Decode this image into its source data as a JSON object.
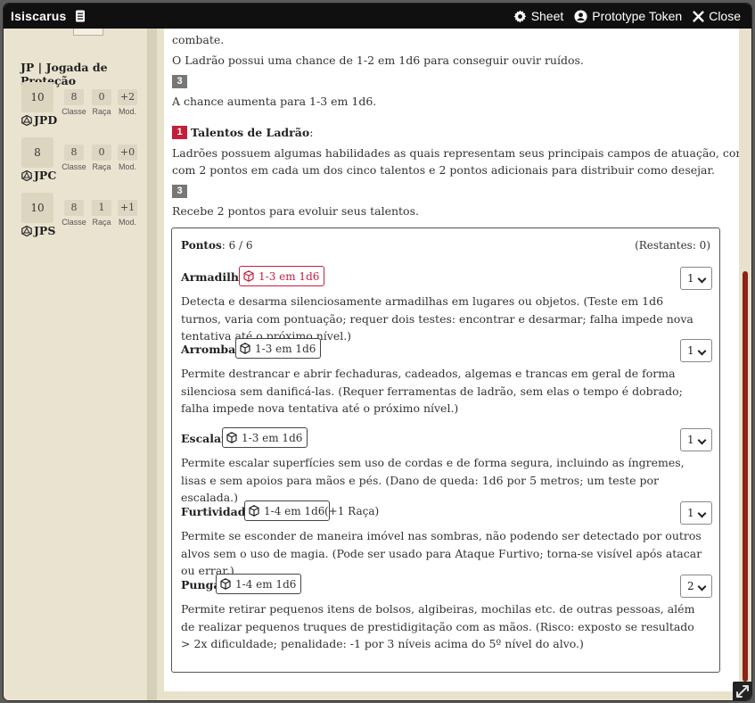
{
  "window": {
    "title": "Isiscarus",
    "sheet_label": "Sheet",
    "token_label": "Prototype Token",
    "close_label": "Close"
  },
  "sidebar": {
    "jp_title": "JP | Jogada de Proteção",
    "saves": [
      {
        "name": "JPD",
        "total": "10",
        "classe": "8",
        "raca": "0",
        "mod": "+2"
      },
      {
        "name": "JPC",
        "total": "8",
        "classe": "8",
        "raca": "0",
        "mod": "+0"
      },
      {
        "name": "JPS",
        "total": "10",
        "classe": "8",
        "raca": "1",
        "mod": "+1"
      }
    ],
    "labels": {
      "classe": "Classe",
      "raca": "Raça",
      "mod": "Mod."
    }
  },
  "main": {
    "line_combat": "combate.",
    "line_hear": "O Ladrão possui uma chance de 1-2 em 1d6 para conseguir ouvir ruídos.",
    "lvl_3a": "3",
    "line_chance": "A chance aumenta para 1-3 em 1d6.",
    "lvl_1": "1",
    "talents_title": "Talentos de Ladrão",
    "talents_colon": ":",
    "talents_desc_1": "Ladrões possuem algumas habilidades as quais representam seus principais campos de atuação, começando",
    "talents_desc_2": "com 2 pontos em cada um dos cinco talentos e 2 pontos adicionais para distribuir como desejar.",
    "lvl_3b": "3",
    "line_receive": "Recebe 2 pontos para evoluir seus talentos.",
    "points_label": "Pontos",
    "points_value": ": 6 / 6",
    "remaining": "(Restantes: 0)",
    "talents": [
      {
        "name": "Armadilha",
        "roll": "1-3 em 1d6",
        "bonus": "",
        "select": "1",
        "desc": "Detecta e desarma silenciosamente armadilhas em lugares ou objetos. (Teste em 1d6 turnos, varia com pontuação; requer dois testes: encontrar e desarmar; falha impede nova tentativa até o próximo nível.)"
      },
      {
        "name": "Arrombar",
        "roll": "1-3 em 1d6",
        "bonus": "",
        "select": "1",
        "desc": "Permite destrancar e abrir fechaduras, cadeados, algemas e trancas em geral de forma silenciosa sem danificá-las. (Requer ferramentas de ladrão, sem elas o tempo é dobrado; falha impede nova tentativa até o próximo nível.)"
      },
      {
        "name": "Escalar",
        "roll": "1-3 em 1d6",
        "bonus": "",
        "select": "1",
        "desc": "Permite escalar superfícies sem uso de cordas e de forma segura, incluindo as íngremes, lisas e sem apoios para mãos e pés. (Dano de queda: 1d6 por 5 metros; um teste por escalada.)"
      },
      {
        "name": "Furtividade",
        "roll": "1-4 em 1d6",
        "bonus": "(+1 Raça)",
        "select": "1",
        "desc": "Permite se esconder de maneira imóvel nas sombras, não podendo ser detectado por outros alvos sem o uso de magia. (Pode ser usado para Ataque Furtivo; torna-se visível após atacar ou errar.)"
      },
      {
        "name": "Punga",
        "roll": "1-4 em 1d6",
        "bonus": "",
        "select": "2",
        "desc": "Permite retirar pequenos itens de bolsos, algibeiras, mochilas etc. de outras pessoas, além de realizar pequenos truques de prestidigitação com as mãos. (Risco: exposto se resultado > 2x dificuldade; penalidade: -1 por 3 níveis acima do 5º nível do alvo.)"
      }
    ]
  },
  "colors": {
    "accent_red": "#c41f3a",
    "scrollbar": "#8b2317",
    "titlebar": "#101010"
  }
}
